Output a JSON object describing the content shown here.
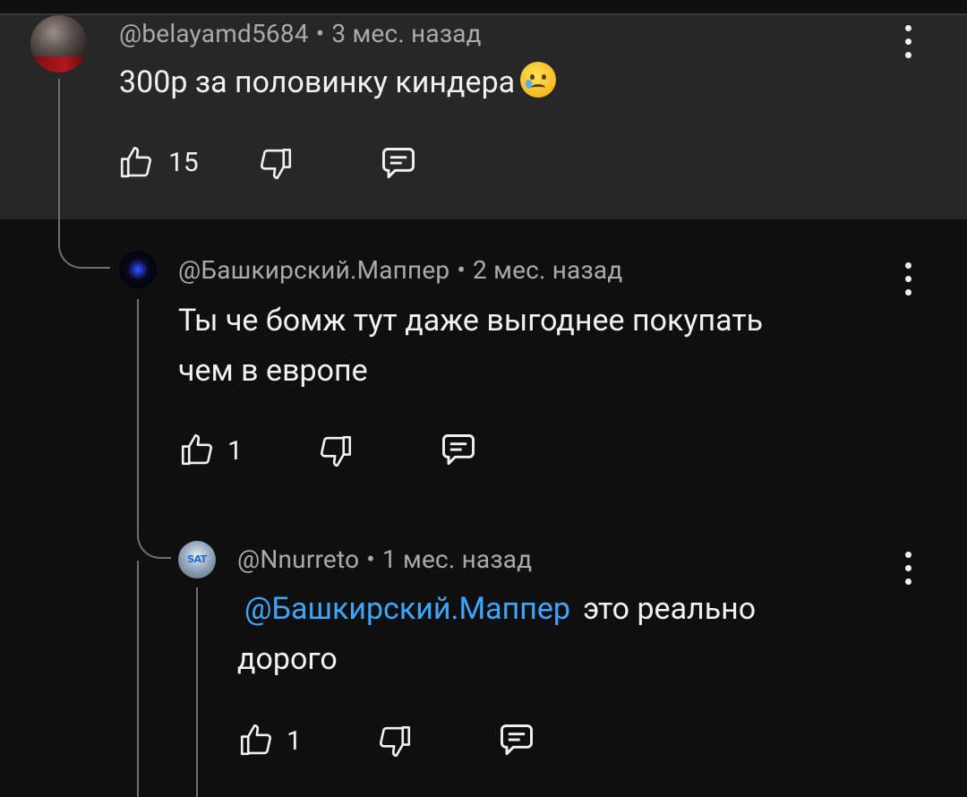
{
  "comments": [
    {
      "author": "@belayamd5684",
      "separator": "•",
      "time": "3 мес. назад",
      "text": "300р за половинку киндера",
      "emoji": "crying-face-emoji",
      "likes": "15"
    },
    {
      "author": "@Башкирский.Маппер",
      "separator": "•",
      "time": "2 мес. назад",
      "text_line1": "Ты че бомж  тут даже выгоднее покупать",
      "text_line2": "чем в европе",
      "likes": "1"
    },
    {
      "author": "@Nnurreto",
      "separator": "•",
      "time": "1 мес. назад",
      "mention": "@Башкирский.Маппер",
      "text_line1": "это реально",
      "text_line2": "дорого",
      "likes": "1",
      "avatar_text": "SAT"
    }
  ],
  "colors": {
    "background": "#0f0f0f",
    "highlight": "#272727",
    "mention": "#3ea6ff",
    "meta": "#aaaaaa",
    "text": "#f1f1f1"
  },
  "icons": [
    "like-icon",
    "dislike-icon",
    "reply-icon",
    "more-vertical-icon"
  ]
}
